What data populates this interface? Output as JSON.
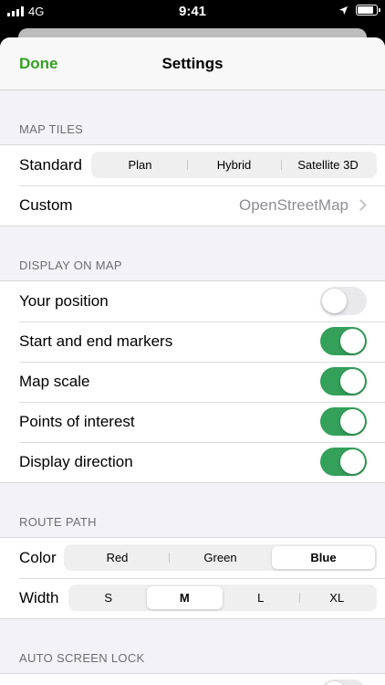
{
  "status_bar": {
    "carrier": "4G",
    "time": "9:41"
  },
  "nav": {
    "done_label": "Done",
    "title": "Settings"
  },
  "map_tiles": {
    "header": "MAP TILES",
    "standard_label": "Standard",
    "standard_options": [
      "Plan",
      "Hybrid",
      "Satellite 3D"
    ],
    "custom_label": "Custom",
    "custom_value": "OpenStreetMap"
  },
  "display_on_map": {
    "header": "DISPLAY ON MAP",
    "items": [
      {
        "label": "Your position",
        "on": false
      },
      {
        "label": "Start and end markers",
        "on": true
      },
      {
        "label": "Map scale",
        "on": true
      },
      {
        "label": "Points of interest",
        "on": true
      },
      {
        "label": "Display direction",
        "on": true
      }
    ]
  },
  "route_path": {
    "header": "ROUTE PATH",
    "color_label": "Color",
    "color_options": [
      "Red",
      "Green",
      "Blue"
    ],
    "color_selected": "Blue",
    "width_label": "Width",
    "width_options": [
      "S",
      "M",
      "L",
      "XL"
    ],
    "width_selected": "M"
  },
  "auto_screen_lock": {
    "header": "AUTO SCREEN LOCK"
  },
  "colors": {
    "accent": "#34a023",
    "toggle_on": "#34a05a"
  }
}
